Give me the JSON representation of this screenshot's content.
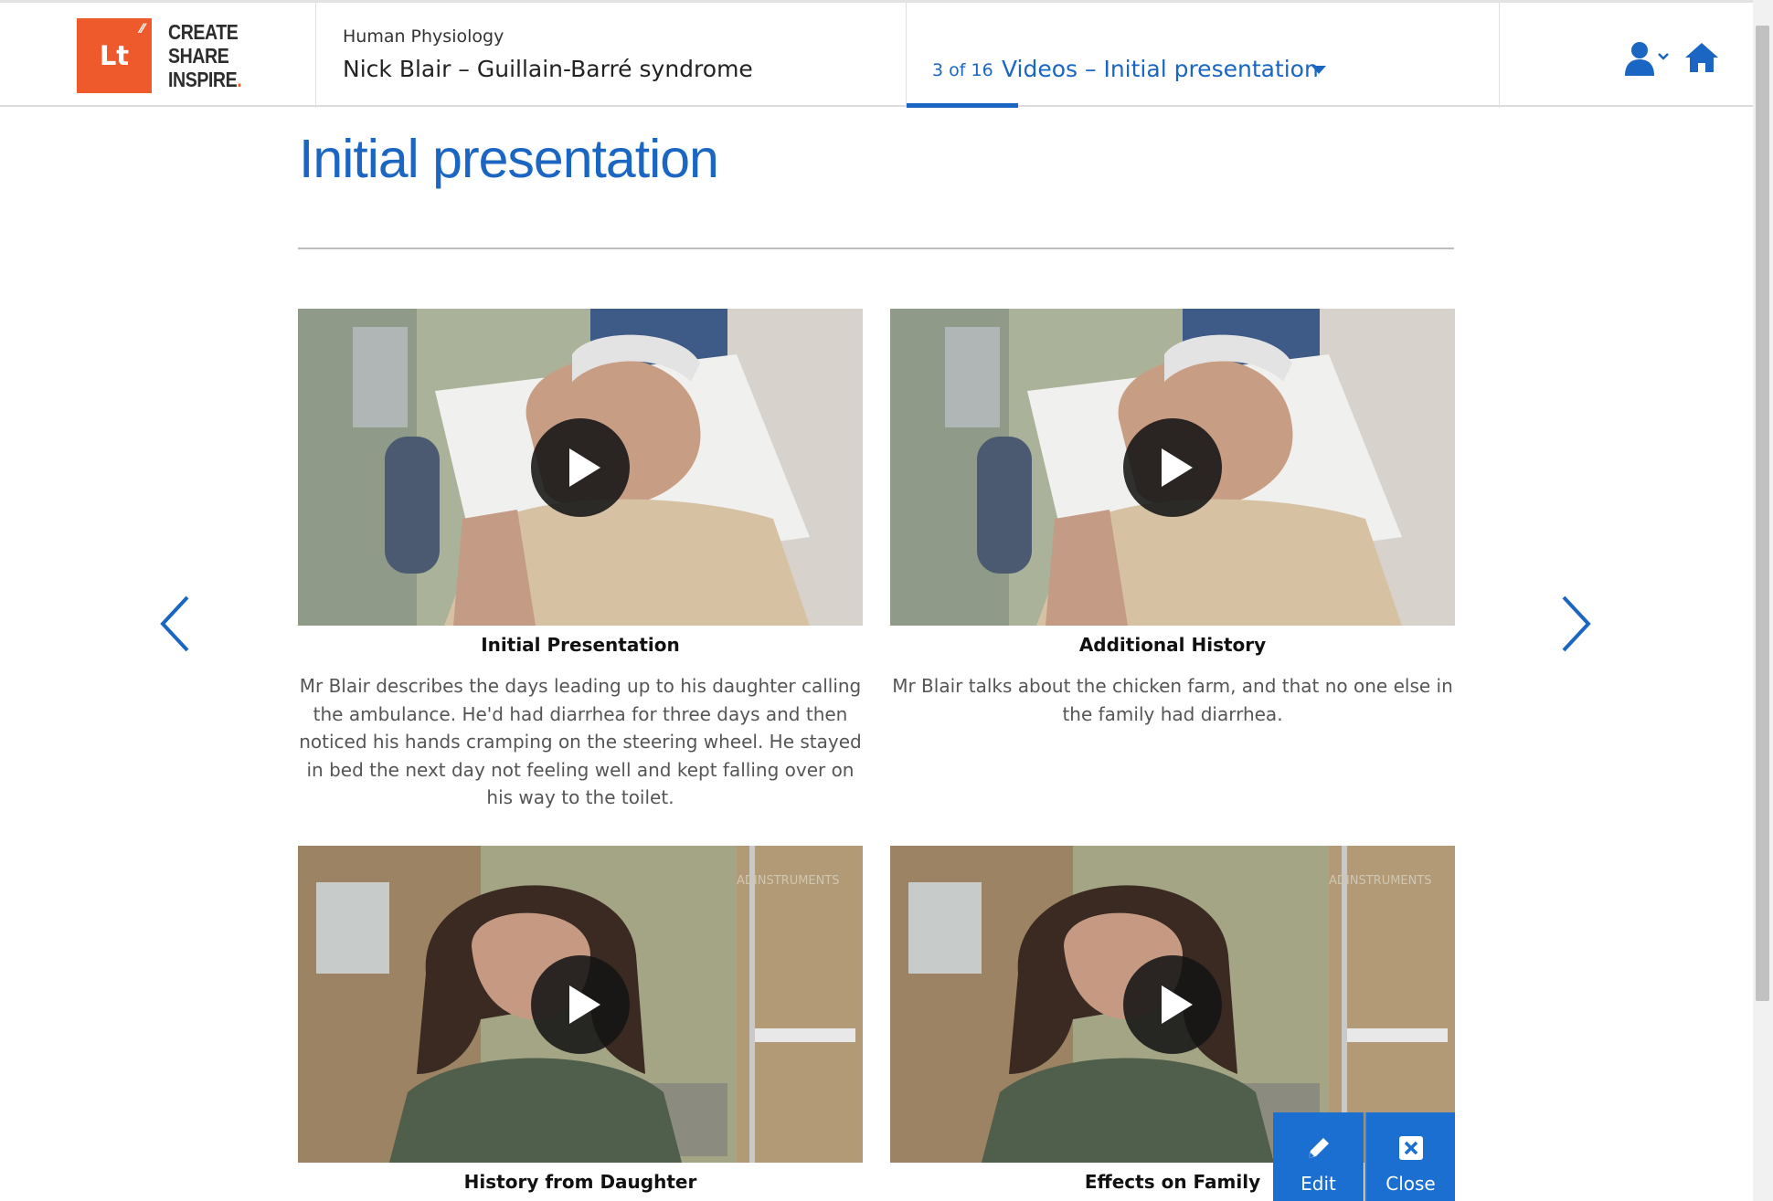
{
  "logo": {
    "mark": "Lt",
    "lines": [
      "CREATE",
      "SHARE",
      "INSPIRE"
    ],
    "dot": "."
  },
  "header": {
    "course": "Human Physiology",
    "lesson": "Nick Blair – Guillain-Barré syndrome",
    "page_count": "3 of 16",
    "page_title": "Videos – Initial presentation"
  },
  "icons": [
    "user-menu-icon",
    "home-icon",
    "chevron-left-icon",
    "chevron-right-icon",
    "play-icon",
    "pencil-icon",
    "close-box-icon"
  ],
  "colors": {
    "accent": "#1a66c2",
    "brand": "#ee5a2c",
    "button": "#1a6fd0"
  },
  "main": {
    "heading": "Initial presentation",
    "videos": [
      {
        "title": "Initial Presentation",
        "description": "Mr Blair describes the days leading up to his daughter calling the ambulance. He'd had diarrhea for three days and then noticed his hands cramping on the steering wheel. He stayed in bed the next day not feeling well and kept falling over on his way to the toilet."
      },
      {
        "title": "Additional History",
        "description": "Mr Blair talks about the chicken farm, and that no one else in the family had diarrhea."
      },
      {
        "title": "History from Daughter",
        "description": ""
      },
      {
        "title": "Effects on Family",
        "description": ""
      }
    ],
    "watermark": "ADINSTRUMENTS"
  },
  "actions": {
    "edit": "Edit",
    "close": "Close"
  }
}
